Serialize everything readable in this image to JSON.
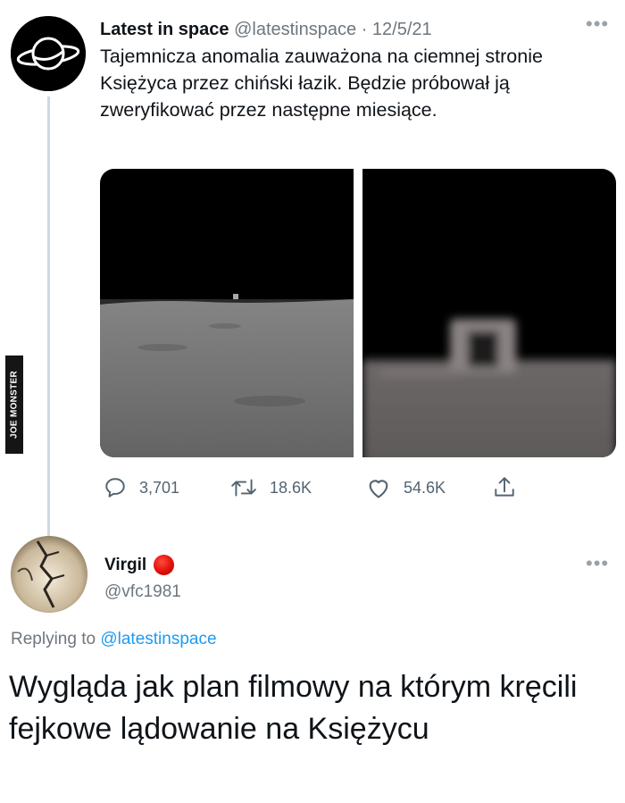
{
  "tweet1": {
    "display_name": "Latest in space",
    "handle": "@latestinspace",
    "date_separator": "·",
    "date": "12/5/21",
    "text": "Tajemnicza anomalia zauważona na ciemnej stronie Księżyca przez chiński łazik. Będzie próbował ją zweryfikować przez następne miesiące.",
    "more_icon": "ellipsis-icon",
    "avatar_icon": "saturn-icon",
    "images": [
      "moon-surface-photo",
      "zoomed-anomaly-photo"
    ],
    "actions": {
      "replies": "3,701",
      "retweets": "18.6K",
      "likes": "54.6K"
    }
  },
  "tweet2": {
    "display_name": "Virgil",
    "handle": "@vfc1981",
    "replying_prefix": "Replying to",
    "replying_to": "@latestinspace",
    "text": "Wygląda jak plan filmowy na którym kręcili fejkowe lądowanie na Księżycu",
    "badge_color": "#e0100a"
  },
  "watermark": "JOE MONSTER",
  "colors": {
    "text": "#0f1419",
    "secondary": "#6e767d",
    "link": "#1d9bf0",
    "thread_line": "#cfd9de"
  }
}
